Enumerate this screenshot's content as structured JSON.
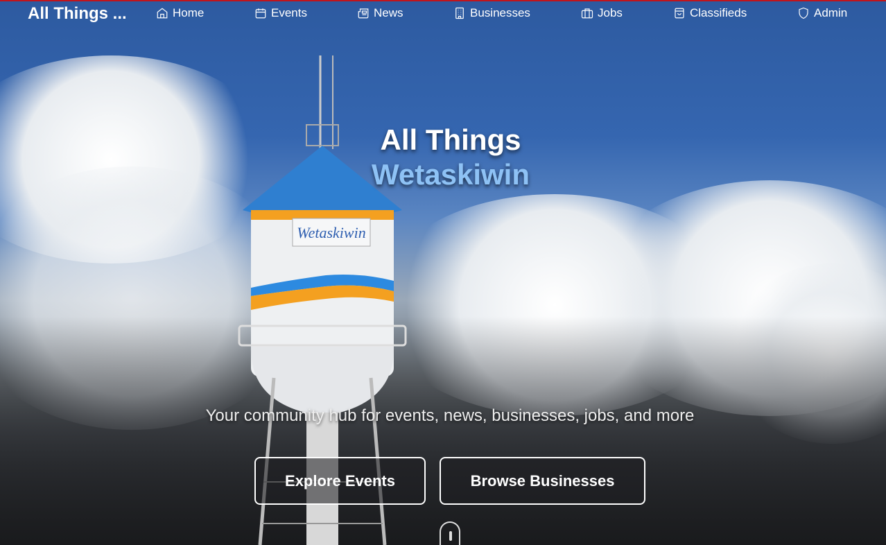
{
  "nav": {
    "brand": "All Things ...",
    "items": [
      {
        "label": "Home",
        "icon": "home-icon"
      },
      {
        "label": "Events",
        "icon": "calendar-icon"
      },
      {
        "label": "News",
        "icon": "newspaper-icon"
      },
      {
        "label": "Businesses",
        "icon": "building-icon"
      },
      {
        "label": "Jobs",
        "icon": "briefcase-icon"
      },
      {
        "label": "Classifieds",
        "icon": "shopping-bag-icon"
      },
      {
        "label": "Admin",
        "icon": "shield-icon"
      }
    ]
  },
  "hero": {
    "title_line1": "All Things",
    "title_line2": "Wetaskiwin",
    "subtitle": "Your community hub for events, news, businesses, jobs, and more",
    "tower_text": "Wetaskiwin",
    "buttons": {
      "explore_events": "Explore Events",
      "browse_businesses": "Browse Businesses"
    }
  },
  "colors": {
    "accent": "#8ec2f5",
    "top_border": "#c0141c"
  }
}
